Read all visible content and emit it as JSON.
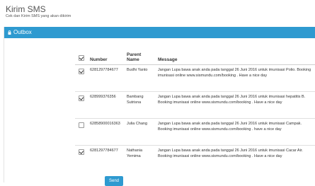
{
  "header": {
    "title": "Kirim SMS",
    "subtitle": "Cek dan Kirim SMS yang akan dikirim"
  },
  "panel": {
    "title": "Outbox",
    "icon": "lock-icon",
    "accent_color": "#2e9ad0"
  },
  "table": {
    "columns": [
      "Number",
      "Parent Name",
      "Message"
    ],
    "header_checked": true,
    "rows": [
      {
        "checked": true,
        "number": "6281297784677",
        "parent_name": "Budhi Yanto",
        "message": "Jangan Lupa bawa anak anda pada tanggal 26 Juni 2016 untuk imunisasi Polio. Booking imunisasi online www.sismundu.com/booking . Have a nice day"
      },
      {
        "checked": true,
        "number": "628999376356",
        "parent_name": "Bambang Sutrisna",
        "message": "Jangan Lupa bawa anak anda pada tanggal 26 Juni 2016 untuk imunisasi hepatitis B. Booking imunisasi online www.sismundu.com/booking . Have a nice day"
      },
      {
        "checked": false,
        "number": "62858900016363",
        "parent_name": "Julia Chang",
        "message": "Jangan Lupa bawa anak anda pada tanggal 26 Juni 2016 untuk imunisasi Campak. Booking imunisasi online www.sismundu.com/booking . have a nice day"
      },
      {
        "checked": true,
        "number": "6281297784677",
        "parent_name": "Nathania Yemima",
        "message": "Jangan Lupa bawa anak anda pada tanggal 26 Juni 2016 untuk imunisasi Cacar Air. Booking imunisasi online www.sismundu.com/booking . Have a nice day"
      }
    ]
  },
  "send_button": {
    "label": "Send"
  }
}
